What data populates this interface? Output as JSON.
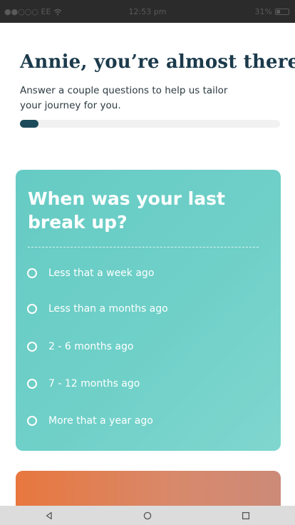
{
  "status_bar": {
    "carrier": "●●○○○ EE",
    "time": "12:53 pm",
    "battery_text": "31%"
  },
  "header": {
    "title": "Annie, you’re almost there",
    "subtitle": "Answer a couple questions to help us tailor your journey for you."
  },
  "progress": {
    "fraction": 0.07
  },
  "question": {
    "title": "When was your last break up?",
    "options": [
      {
        "label": "Less that a week ago"
      },
      {
        "label": "Less than a months ago"
      },
      {
        "label": "2 - 6 months ago"
      },
      {
        "label": "7 - 12 months ago"
      },
      {
        "label": "More that a year ago"
      }
    ]
  },
  "colors": {
    "title": "#1b3a4b",
    "progress_fill": "#1b4b5a",
    "card_teal": "#6fd0c8",
    "card_orange": "#e8773e"
  },
  "nav_bar": {
    "icons": [
      "back-triangle-icon",
      "home-circle-icon",
      "recents-square-icon"
    ]
  }
}
